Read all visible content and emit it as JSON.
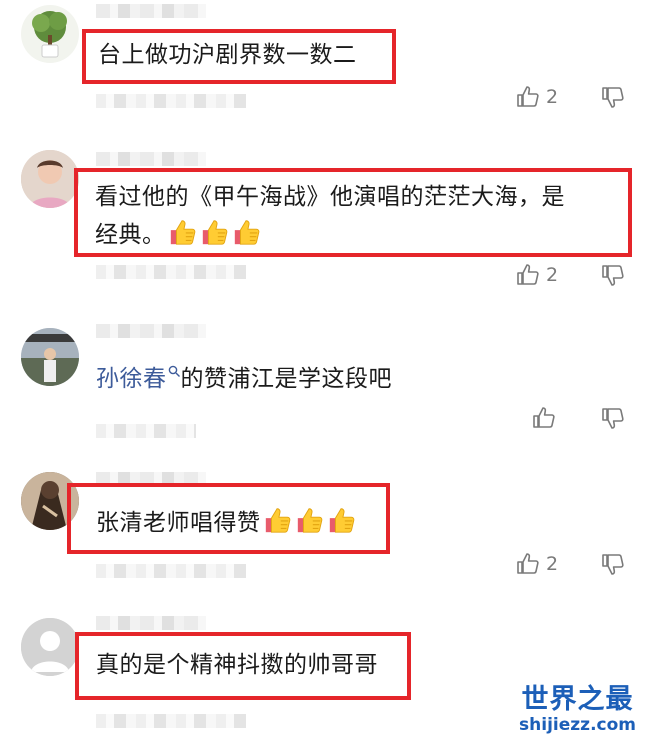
{
  "comments": [
    {
      "text": "台上做功沪剧界数一数二",
      "likes": "2",
      "avatar": "potted-tree"
    },
    {
      "text_line1": "看过他的《甲午海战》他演唱的茫茫大海，是",
      "text_line2": "经典。",
      "likes": "2",
      "avatar": "woman"
    },
    {
      "mention": "孙徐春",
      "mention_icon": "search-icon",
      "text": "的赞浦江是学这段吧",
      "likes": "",
      "avatar": "person-street"
    },
    {
      "text": "张清老师唱得赞",
      "likes": "2",
      "avatar": "dark-photo"
    },
    {
      "text": "真的是个精神抖擞的帅哥哥",
      "likes": "",
      "avatar": "default-person"
    }
  ],
  "watermark": {
    "main": "世界之最",
    "sub": "shijiezz.com"
  },
  "colors": {
    "highlight": "#e5252a",
    "mention": "#3d5b9a",
    "icon": "#7a7a7a",
    "watermark": "#1c5fb8"
  }
}
